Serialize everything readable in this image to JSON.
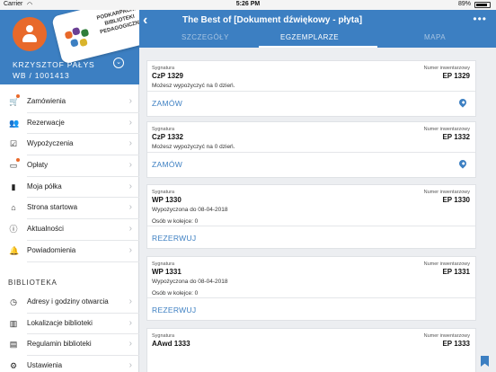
{
  "status": {
    "carrier": "Carrier",
    "time": "5:26 PM",
    "battery": "89%"
  },
  "sidebar": {
    "user_name": "KRZYSZTOF PAŁYS",
    "user_id": "WB / 1001413",
    "logo_text": "PODKARPACKIE BIBLIOTEKI PEDAGOGICZNE",
    "items": [
      {
        "label": "Zamówienia",
        "icon": "cart-icon",
        "badge": true
      },
      {
        "label": "Rezerwacje",
        "icon": "people-icon",
        "badge": false
      },
      {
        "label": "Wypożyczenia",
        "icon": "checkbox-icon",
        "badge": false
      },
      {
        "label": "Opłaty",
        "icon": "card-icon",
        "badge": true
      },
      {
        "label": "Moja półka",
        "icon": "bookmark-icon",
        "badge": false
      },
      {
        "label": "Strona startowa",
        "icon": "home-icon",
        "badge": false
      },
      {
        "label": "Aktualności",
        "icon": "info-icon",
        "badge": false
      },
      {
        "label": "Powiadomienia",
        "icon": "bell-icon",
        "badge": false
      }
    ],
    "section_title": "BIBLIOTEKA",
    "library_items": [
      {
        "label": "Adresy i godziny otwarcia",
        "icon": "clock-icon"
      },
      {
        "label": "Lokalizacje biblioteki",
        "icon": "books-icon"
      },
      {
        "label": "Regulamin biblioteki",
        "icon": "document-icon"
      },
      {
        "label": "Ustawienia",
        "icon": "gear-icon"
      }
    ]
  },
  "header": {
    "title": "The Best of [Dokument dźwiękowy - płyta]",
    "tabs": [
      "SZCZEGÓŁY",
      "EGZEMPLARZE",
      "MAPA"
    ],
    "active_tab": "EGZEMPLARZE"
  },
  "labels": {
    "signature": "Sygnatura",
    "inventory": "Numer inwentarzowy"
  },
  "copies": [
    {
      "signature": "CzP 1329",
      "inventory": "EP 1329",
      "info1": "Możesz wypożyczyć na 0 dzień.",
      "info2": "",
      "action": "ZAMÓW",
      "has_map": true
    },
    {
      "signature": "CzP 1332",
      "inventory": "EP 1332",
      "info1": "Możesz wypożyczyć na 0 dzień.",
      "info2": "",
      "action": "ZAMÓW",
      "has_map": true
    },
    {
      "signature": "WP 1330",
      "inventory": "EP 1330",
      "info1": "Wypożyczona do 08-04-2018",
      "info2": "Osób w kolejce: 0",
      "action": "REZERWUJ",
      "has_map": false
    },
    {
      "signature": "WP 1331",
      "inventory": "EP 1331",
      "info1": "Wypożyczona do 08-04-2018",
      "info2": "Osób w kolejce: 0",
      "action": "REZERWUJ",
      "has_map": false
    },
    {
      "signature": "AAwd 1333",
      "inventory": "EP 1333",
      "info1": "",
      "info2": "",
      "action": "",
      "has_map": false
    }
  ],
  "colors": {
    "primary": "#3c7fc2",
    "accent": "#e8692a",
    "background": "#eceef1"
  }
}
